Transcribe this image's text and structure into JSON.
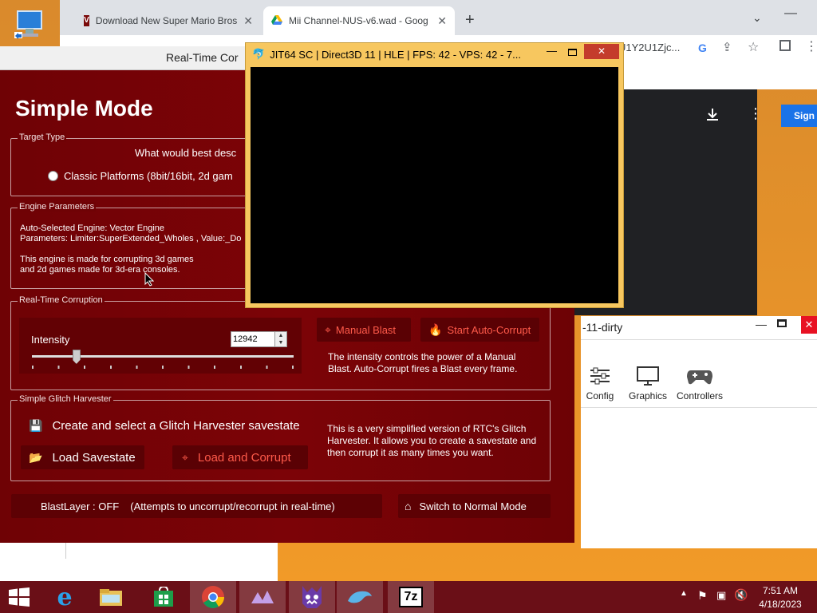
{
  "chrome": {
    "tabs": [
      {
        "title": "Download New Super Mario Bros"
      },
      {
        "title": "Mii Channel-NUS-v6.wad - Goog"
      }
    ],
    "new_tab": "+",
    "address_tail": "U1Y2U1Zjc...",
    "sign_in": "Sign"
  },
  "rtc": {
    "window_title": "Real-Time Cor",
    "heading": "Simple Mode",
    "target_type": {
      "legend": "Target Type",
      "question": "What would best desc",
      "option": "Classic Platforms (8bit/16bit, 2d gam"
    },
    "engine": {
      "legend": "Engine Parameters",
      "line1": "Auto-Selected Engine: Vector Engine",
      "line2": "Parameters: Limiter:SuperExtended_Wholes , Value:_Do",
      "line3": "This engine is made for corrupting 3d games",
      "line4": "and 2d games made for 3d-era consoles."
    },
    "realtime": {
      "legend": "Real-Time Corruption",
      "intensity_label": "Intensity",
      "intensity_value": "12942",
      "intensity_fraction": 0.17,
      "manual_blast": "Manual Blast",
      "auto_corrupt": "Start Auto-Corrupt",
      "help1": "The intensity controls the power of a Manual",
      "help2": "Blast. Auto-Corrupt fires a Blast every frame."
    },
    "harvester": {
      "legend": "Simple Glitch Harvester",
      "create": "Create and select a Glitch Harvester savestate",
      "load": "Load Savestate",
      "load_corrupt": "Load and Corrupt",
      "help1": "This is a very simplified version of RTC's Glitch",
      "help2": "Harvester. It allows you to create a savestate and",
      "help3": "then corrupt it as many times you want."
    },
    "blastlayer": "BlastLayer : OFF",
    "blastlayer_note": "(Attempts to uncorrupt/recorrupt in real-time)",
    "switch_mode": "Switch to Normal Mode"
  },
  "dolphin": {
    "render_title": "JIT64 SC | Direct3D 11 | HLE | FPS: 42 - VPS: 42 - 7...",
    "main_title": "-11-dirty",
    "toolbar": [
      {
        "label": "Config",
        "icon": "config-icon"
      },
      {
        "label": "Graphics",
        "icon": "monitor-icon"
      },
      {
        "label": "Controllers",
        "icon": "gamepad-icon"
      }
    ]
  },
  "taskbar": {
    "time": "7:51 AM",
    "date": "4/18/2023"
  }
}
